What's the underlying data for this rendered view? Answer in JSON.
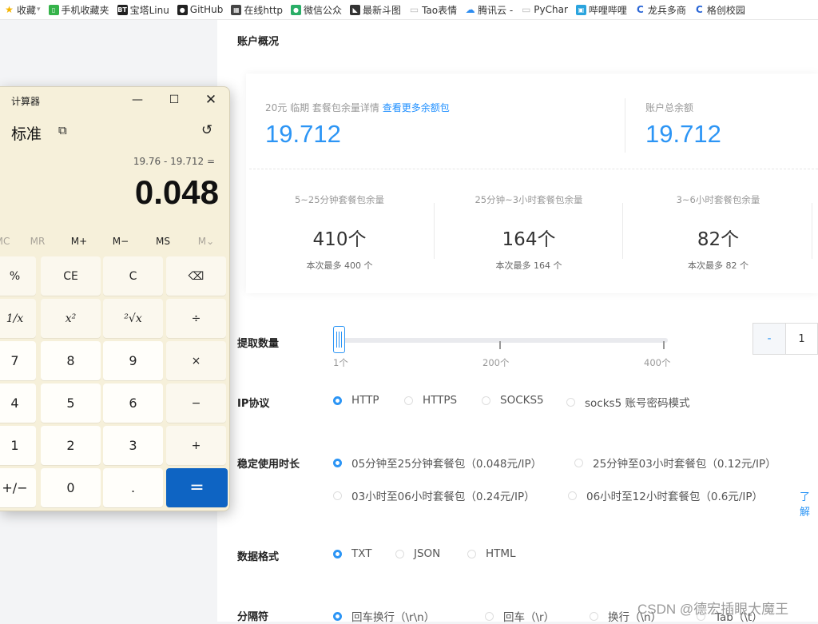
{
  "bookmarks": [
    {
      "label": "收藏",
      "icon": "star-icon",
      "color": "#f5b400"
    },
    {
      "label": "手机收藏夹",
      "icon": "phone-icon",
      "color": "#35b34a"
    },
    {
      "label": "宝塔Linu",
      "icon": "bt-icon",
      "color": "#222222"
    },
    {
      "label": "GitHub",
      "icon": "github-icon",
      "color": "#222222"
    },
    {
      "label": "在线http",
      "icon": "qr-icon",
      "color": "#444444"
    },
    {
      "label": "微信公众",
      "icon": "wechat-icon",
      "color": "#2aae67"
    },
    {
      "label": "最新斗图",
      "icon": "tag-icon",
      "color": "#333333"
    },
    {
      "label": "Tao表情",
      "icon": "page-icon",
      "color": "#bbbbbb"
    },
    {
      "label": "腾讯云 -",
      "icon": "cloud-icon",
      "color": "#2c8cf0"
    },
    {
      "label": "PyChar",
      "icon": "page-icon",
      "color": "#bbbbbb"
    },
    {
      "label": "哔哩哔哩",
      "icon": "bilibili-icon",
      "color": "#2aa4de"
    },
    {
      "label": "龙兵多商",
      "icon": "c-icon",
      "color": "#2a66d6"
    },
    {
      "label": "格创校园",
      "icon": "c-icon",
      "color": "#2a66d6"
    }
  ],
  "overview": {
    "title": "账户概况",
    "balance_label_prefix": "20元 临期 套餐包余量详情",
    "balance_link": "查看更多余额包",
    "balance_value": "19.712",
    "total_label": "账户总余额",
    "total_value": "19.712",
    "packages": [
      {
        "title": "5~25分钟套餐包余量",
        "value": "410个",
        "sub": "本次最多 400 个"
      },
      {
        "title": "25分钟~3小时套餐包余量",
        "value": "164个",
        "sub": "本次最多 164 个"
      },
      {
        "title": "3~6小时套餐包余量",
        "value": "82个",
        "sub": "本次最多 82 个"
      }
    ]
  },
  "form": {
    "quantity_label": "提取数量",
    "slider_marks": [
      "1个",
      "200个",
      "400个"
    ],
    "slider_fraction": 0,
    "stepper_minus": "-",
    "stepper_value": "1",
    "protocol_label": "IP协议",
    "protocols": [
      "HTTP",
      "HTTPS",
      "SOCKS5",
      "socks5 账号密码模式"
    ],
    "duration_label": "稳定使用时长",
    "durations": [
      "05分钟至25分钟套餐包（0.048元/IP）",
      "25分钟至03小时套餐包（0.12元/IP）",
      "03小时至06小时套餐包（0.24元/IP）",
      "06小时至12小时套餐包（0.6元/IP）"
    ],
    "learn_link": "了解",
    "format_label": "数据格式",
    "formats": [
      "TXT",
      "JSON",
      "HTML"
    ],
    "separator_label": "分隔符",
    "separators": [
      "回车换行（\\r\\n）",
      "回车（\\r）",
      "换行（\\n）",
      "Tab（\\t）"
    ]
  },
  "watermark": "CSDN @德宏插眼大魔王",
  "calculator": {
    "title": "计算器",
    "mode": "标准",
    "expression": "19.76 - 19.712 =",
    "result": "0.048",
    "memory": [
      "MC",
      "MR",
      "M+",
      "M−",
      "MS",
      "M⌄"
    ],
    "keys": [
      [
        "%",
        "CE",
        "C",
        "⌫"
      ],
      [
        "1/x",
        "x²",
        "²√x",
        "÷"
      ],
      [
        "7",
        "8",
        "9",
        "×"
      ],
      [
        "4",
        "5",
        "6",
        "−"
      ],
      [
        "1",
        "2",
        "3",
        "+"
      ],
      [
        "+/−",
        "0",
        ".",
        "="
      ]
    ]
  }
}
